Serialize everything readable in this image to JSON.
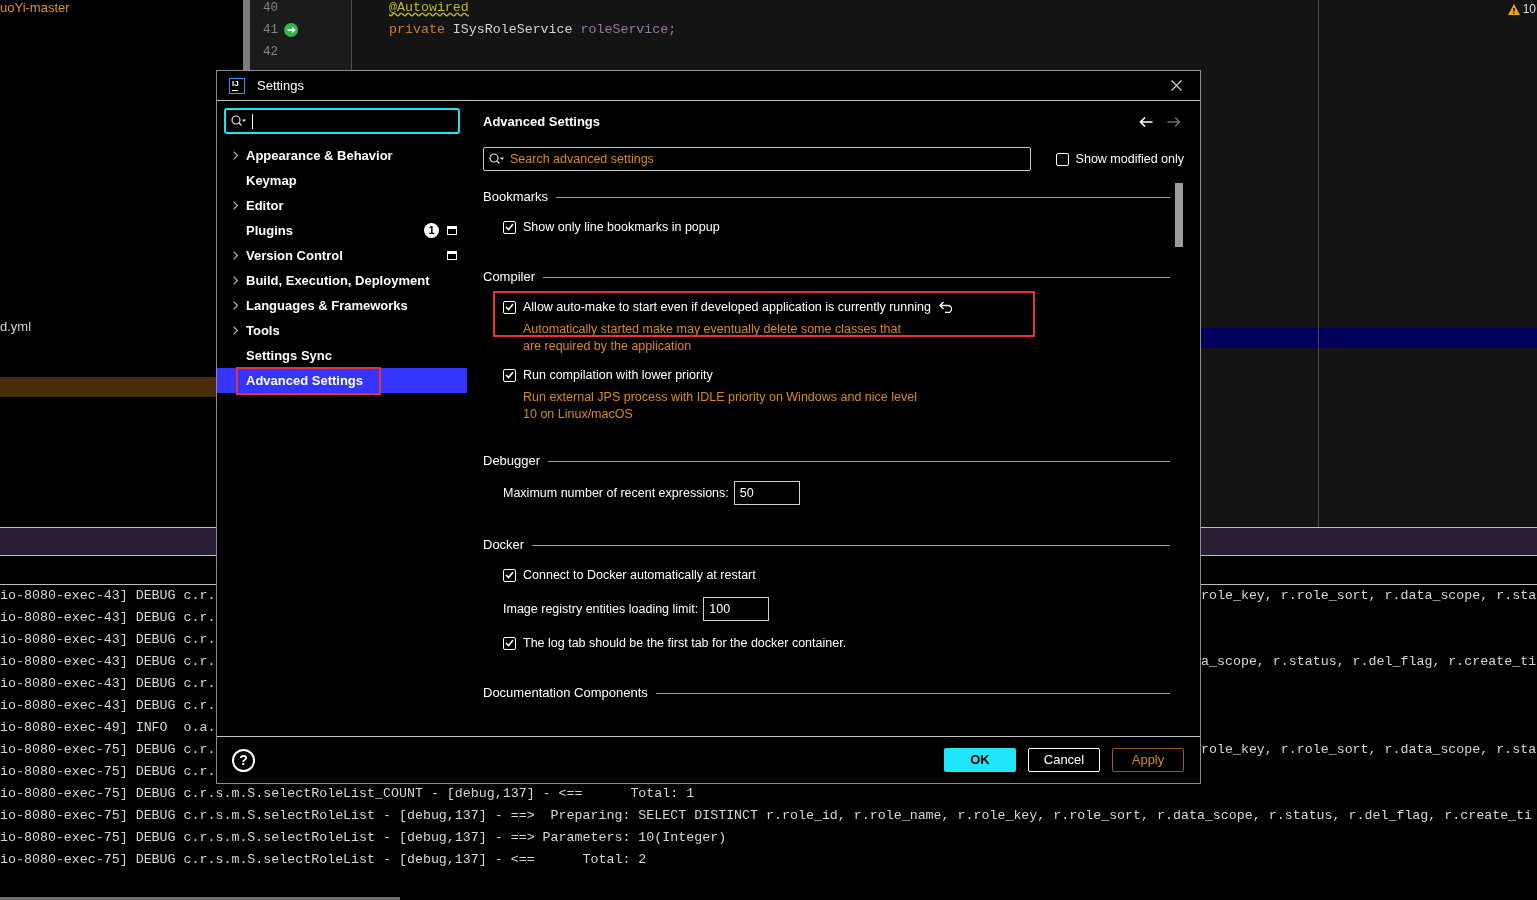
{
  "editor": {
    "lines": [
      {
        "number": "40",
        "gutter_icon": false,
        "tokens": [
          {
            "text": "@Autowired",
            "kind": "annotation",
            "warning": true
          }
        ]
      },
      {
        "number": "41",
        "gutter_icon": true,
        "tokens": [
          {
            "text": "private",
            "kind": "keyword",
            "warning": false
          },
          {
            "text": " ISysRoleService ",
            "kind": "plain",
            "warning": false
          },
          {
            "text": "roleService",
            "kind": "field",
            "warning": false
          },
          {
            "text": ";",
            "kind": "keyword",
            "warning": false
          }
        ]
      },
      {
        "number": "42",
        "gutter_icon": false
      }
    ],
    "warning_count": "10"
  },
  "project_panel": {
    "rows": [
      {
        "label": "uoYi-master",
        "color": "#e08c2e",
        "selected": false
      },
      {
        "label": "d.yml",
        "color": "#d2d2d2",
        "selected": false
      },
      {
        "selected": true
      }
    ]
  },
  "dialog": {
    "logo": "IJ",
    "title": "Settings",
    "sidebar": {
      "search": {
        "focused": true
      },
      "items": [
        {
          "label": "Appearance & Behavior",
          "kind": "group",
          "selected": false,
          "marked": false,
          "scope_icon": false
        },
        {
          "label": "Keymap",
          "kind": "page",
          "selected": false,
          "marked": false,
          "scope_icon": false
        },
        {
          "label": "Editor",
          "kind": "group",
          "selected": false,
          "marked": false,
          "scope_icon": false
        },
        {
          "label": "Plugins",
          "kind": "page",
          "selected": false,
          "marked": false,
          "scope_icon": true,
          "badge": "1"
        },
        {
          "label": "Version Control",
          "kind": "group",
          "selected": false,
          "marked": false,
          "scope_icon": true
        },
        {
          "label": "Build, Execution, Deployment",
          "kind": "group",
          "selected": false,
          "marked": false,
          "scope_icon": false
        },
        {
          "label": "Languages & Frameworks",
          "kind": "group",
          "selected": false,
          "marked": false,
          "scope_icon": false
        },
        {
          "label": "Tools",
          "kind": "group",
          "selected": false,
          "marked": false,
          "scope_icon": false
        },
        {
          "label": "Settings Sync",
          "kind": "page",
          "selected": false,
          "marked": false,
          "scope_icon": false
        },
        {
          "label": "Advanced Settings",
          "kind": "page",
          "selected": true,
          "marked": true,
          "scope_icon": false
        }
      ]
    },
    "panel": {
      "title": "Advanced Settings",
      "nav": [
        {
          "kind": "back",
          "enabled": true
        },
        {
          "kind": "forward",
          "enabled": false
        }
      ],
      "search": {
        "placeholder": "Search advanced settings"
      },
      "filter": {
        "label": "Show modified only",
        "checked": false
      },
      "sections": [
        {
          "title": "Bookmarks",
          "items": [
            {
              "kind": "checkbox",
              "label": "Show only line bookmarks in popup",
              "checked": true,
              "modified": false,
              "marked": false
            }
          ]
        },
        {
          "title": "Compiler",
          "items": [
            {
              "kind": "checkbox",
              "label": "Allow auto-make to start even if developed application is currently running",
              "checked": true,
              "modified": true,
              "marked": true,
              "description": "Automatically started make may eventually delete some classes that are required by the application"
            },
            {
              "kind": "checkbox",
              "label": "Run compilation with lower priority",
              "checked": true,
              "modified": false,
              "marked": false,
              "description": "Run external JPS process with IDLE priority on Windows and nice level 10 on Linux/macOS"
            }
          ]
        },
        {
          "title": "Debugger",
          "items": [
            {
              "kind": "number",
              "label": "Maximum number of recent expressions:",
              "value": "50"
            }
          ]
        },
        {
          "title": "Docker",
          "items": [
            {
              "kind": "checkbox",
              "label": "Connect to Docker automatically at restart",
              "checked": true,
              "modified": false,
              "marked": false
            },
            {
              "kind": "number",
              "label": "Image registry entities loading limit:",
              "value": "100"
            },
            {
              "kind": "checkbox",
              "label": "The log tab should be the first tab for the docker container.",
              "checked": true,
              "modified": false,
              "marked": false
            }
          ]
        },
        {
          "title": "Documentation Components"
        }
      ]
    },
    "footer": {
      "help": "?",
      "buttons": [
        {
          "label": "OK",
          "kind": "primary",
          "disabled": false
        },
        {
          "label": "Cancel",
          "kind": "normal",
          "disabled": false
        },
        {
          "label": "Apply",
          "kind": "normal",
          "disabled": true
        }
      ]
    }
  },
  "console": {
    "lines": [
      {
        "text": "io-8080-exec-43] DEBUG c.r.",
        "continuation": "role_key, r.role_sort, r.data_scope, r.sta"
      },
      {
        "text": "io-8080-exec-43] DEBUG c.r."
      },
      {
        "text": "io-8080-exec-43] DEBUG c.r."
      },
      {
        "text": "io-8080-exec-43] DEBUG c.r.",
        "continuation": "a_scope, r.status, r.del_flag, r.create_ti"
      },
      {
        "text": "io-8080-exec-43] DEBUG c.r."
      },
      {
        "text": "io-8080-exec-43] DEBUG c.r."
      },
      {
        "text": "io-8080-exec-49] INFO  o.a."
      },
      {
        "text": "io-8080-exec-75] DEBUG c.r.",
        "continuation": "role_key, r.role_sort, r.data_scope, r.sta"
      },
      {
        "text": "io-8080-exec-75] DEBUG c.r."
      },
      {
        "text": "io-8080-exec-75] DEBUG c.r.s.m.S.selectRoleList_COUNT - [debug,137] - <==      Total: 1"
      },
      {
        "text": "io-8080-exec-75] DEBUG c.r.s.m.S.selectRoleList - [debug,137] - ==>  Preparing: SELECT DISTINCT r.role_id, r.role_name, r.role_key, r.role_sort, r.data_scope, r.status, r.del_flag, r.create_ti"
      },
      {
        "text": "io-8080-exec-75] DEBUG c.r.s.m.S.selectRoleList - [debug,137] - ==> Parameters: 10(Integer)"
      },
      {
        "text": "io-8080-exec-75] DEBUG c.r.s.m.S.selectRoleList - [debug,137] - <==      Total: 2"
      }
    ]
  }
}
